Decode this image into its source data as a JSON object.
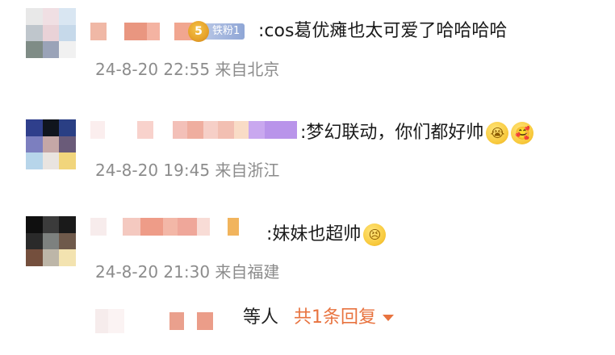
{
  "comments": [
    {
      "text": ":cos葛优瘫也太可爱了哈哈哈哈",
      "meta": "24-8-20 22:55 来自北京",
      "badge": {
        "icon": "fan-badge-icon",
        "label": "铁粉1"
      },
      "emojis": []
    },
    {
      "text": ":梦幻联动，你们都好帅",
      "meta": "24-8-20 19:45 来自浙江",
      "emojis": [
        {
          "icon": "crying-face-emoji"
        },
        {
          "icon": "heart-face-emoji"
        }
      ]
    },
    {
      "text": ":妹妹也超帅",
      "meta": "24-8-20 21:30 来自福建",
      "emojis": [
        {
          "icon": "sobbing-face-emoji"
        }
      ]
    }
  ],
  "reply": {
    "suffix": "等人",
    "count_label": "共1条回复",
    "expand_icon": "caret-down-icon"
  },
  "colors": {
    "meta_gray": "#8c8c8c",
    "reply_orange": "#e8733f"
  }
}
